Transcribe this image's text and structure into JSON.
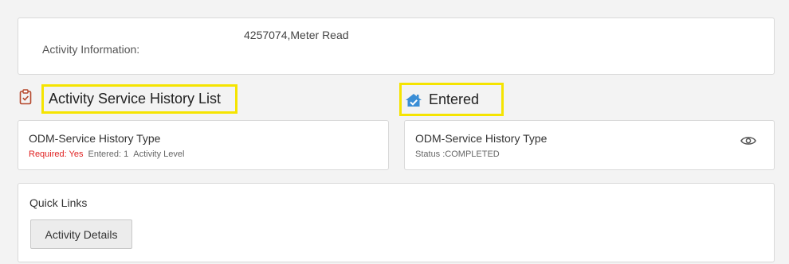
{
  "activity": {
    "label": "Activity Information:",
    "value": "4257074,Meter Read"
  },
  "history_list": {
    "title": "Activity Service History List",
    "item": {
      "title": "ODM-Service History Type",
      "required_label": "Required: Yes",
      "entered_label": "Entered: 1",
      "level_label": "Activity Level"
    }
  },
  "entered": {
    "title": "Entered",
    "item": {
      "title": "ODM-Service History Type",
      "status": "Status :COMPLETED"
    }
  },
  "quick_links": {
    "title": "Quick Links",
    "button_label": "Activity Details"
  },
  "icons": {
    "clipboard": "clipboard-check-icon",
    "entered": "home-check-icon",
    "view": "eye-icon"
  },
  "colors": {
    "highlight": "#f5e400",
    "required": "#e02020",
    "clipboard": "#b5472b",
    "entered_icon": "#3a8ed6"
  }
}
